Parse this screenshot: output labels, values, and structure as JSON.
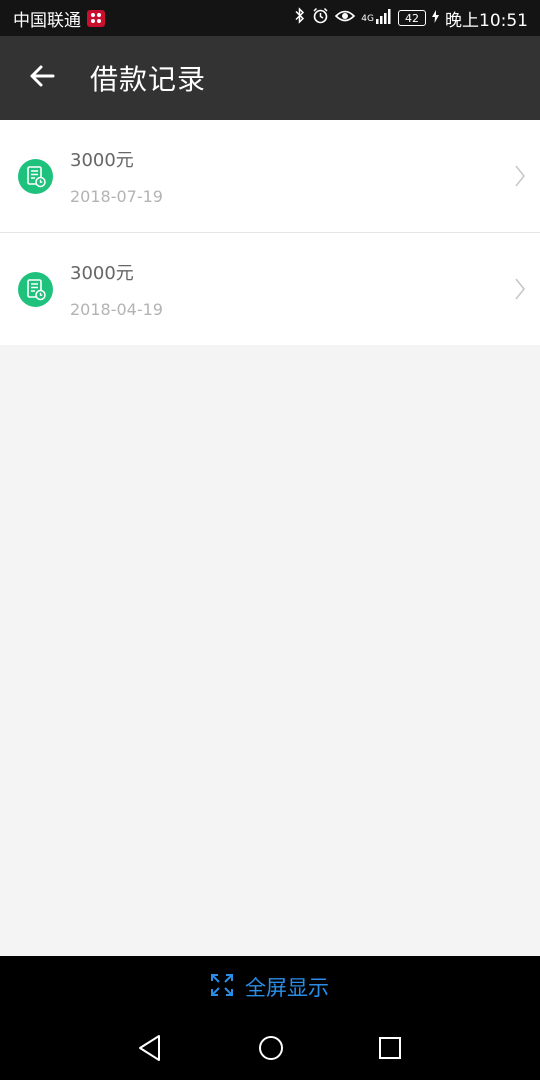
{
  "status_bar": {
    "carrier": "中国联通",
    "network": "4G",
    "battery": "42",
    "time": "晚上10:51"
  },
  "app_bar": {
    "title": "借款记录",
    "back_icon": "arrow-left-icon"
  },
  "records": [
    {
      "amount": "3000元",
      "date": "2018-07-19",
      "icon": "document-clock-icon"
    },
    {
      "amount": "3000元",
      "date": "2018-04-19",
      "icon": "document-clock-icon"
    }
  ],
  "fullscreen": {
    "label": "全屏显示",
    "icon": "expand-icon"
  },
  "colors": {
    "app_bar_bg": "#333333",
    "record_icon": "#1fc27d",
    "fullscreen_text": "#2a8ee8"
  }
}
